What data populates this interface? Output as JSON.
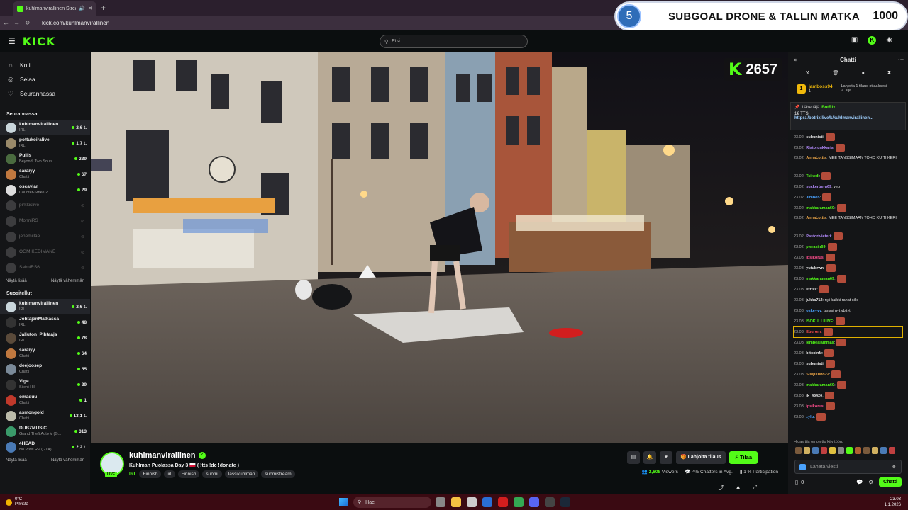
{
  "browser": {
    "tab_title": "kuhlmanvirallinen Stream",
    "url": "kick.com/kuhlmanvirallinen"
  },
  "goal_overlay": {
    "number": "5",
    "text": "SUBGOAL DRONE & TALLIN MATKA",
    "value": "1000"
  },
  "topnav": {
    "logo": "KICK",
    "search_placeholder": "Etsi"
  },
  "sidebar": {
    "nav": [
      {
        "label": "Koti",
        "icon": "home-icon"
      },
      {
        "label": "Selaa",
        "icon": "browse-icon"
      },
      {
        "label": "Seurannassa",
        "icon": "heart-icon"
      }
    ],
    "following_title": "Seurannassa",
    "following": [
      {
        "name": "kuhlmanvirallinen",
        "category": "IRL",
        "viewers": "2,6 t.",
        "color": "#c9d6dc",
        "active": true
      },
      {
        "name": "pottukoiralive",
        "category": "IRL",
        "viewers": "1,7 t.",
        "color": "#9a8a6a"
      },
      {
        "name": "Pullis",
        "category": "Beyond: Two Souls",
        "viewers": "239",
        "color": "#4a6b3f"
      },
      {
        "name": "saraiyy",
        "category": "Chatti",
        "viewers": "67",
        "color": "#c0783f"
      },
      {
        "name": "oscaviar",
        "category": "Counter-Strike 2",
        "viewers": "29",
        "color": "#ddd"
      },
      {
        "name": "pirkkislive",
        "offline": true,
        "color": "#888"
      },
      {
        "name": "MonniRS",
        "offline": true,
        "color": "#888"
      },
      {
        "name": "jenemillae",
        "offline": true,
        "color": "#888"
      },
      {
        "name": "OGMIKEDIMANE",
        "offline": true,
        "color": "#888"
      },
      {
        "name": "SaimiRS6",
        "offline": true,
        "color": "#888"
      }
    ],
    "show_more": "Näytä lisää",
    "show_less": "Näytä vähemmän",
    "recommended_title": "Suositellut",
    "recommended": [
      {
        "name": "kuhlmanvirallinen",
        "category": "IRL",
        "viewers": "2,6 t.",
        "color": "#c9d6dc",
        "active": true
      },
      {
        "name": "JohtajanMatkassa",
        "category": "IRL",
        "viewers": "48",
        "color": "#333"
      },
      {
        "name": "Jaliuton_Pihtaaja",
        "category": "IRL",
        "viewers": "78",
        "color": "#5a4a3a"
      },
      {
        "name": "saraiyy",
        "category": "Chatti",
        "viewers": "64",
        "color": "#c0783f"
      },
      {
        "name": "deejoosep",
        "category": "Chatti",
        "viewers": "55",
        "color": "#7a8a99"
      },
      {
        "name": "Vige",
        "category": "Silent Hill",
        "viewers": "29",
        "color": "#333"
      },
      {
        "name": "omaquu",
        "category": "Chatti",
        "viewers": "1",
        "color": "#c0392b"
      },
      {
        "name": "asmongold",
        "category": "Chatti",
        "viewers": "13,1 t.",
        "color": "#bba"
      },
      {
        "name": "DUBZMUSIC",
        "category": "Grand Theft Auto V (G...",
        "viewers": "313",
        "color": "#3a9a6a"
      },
      {
        "name": "4HEAD",
        "category": "No Pixel RP (GTA)",
        "viewers": "2,2 t.",
        "color": "#4a7ab5"
      }
    ]
  },
  "video": {
    "k_counter": "2657"
  },
  "stream_info": {
    "live_badge": "LIVE",
    "streamer": "kuhlmanvirallinen",
    "title": "Kuhlman Puolassa Day 3 🇵🇱 ( !tts !dc !donate )",
    "category": "IRL",
    "tags": [
      "Finnish",
      "irl",
      "Finnish",
      "suomi",
      "lassikuhlman",
      "suomistream"
    ],
    "gift_label": "Lahjoita tilaus",
    "subscribe_label": "Tilaa",
    "viewers": "2,608",
    "viewers_label": "Viewers",
    "chatters": "4%",
    "chatters_label": "Chatters in Avg.",
    "participation": "1 %",
    "participation_label": "Participation"
  },
  "chat": {
    "title": "Chatti",
    "top_gifter": {
      "rank": "1",
      "name": "jamboss94",
      "count": "1",
      "text": "Lahjoita 1 tilaus ottaaksesi 2. sija"
    },
    "pinned": {
      "sender_label": "Lähettäjä",
      "sender": "BotRix",
      "text": "1€ TTS:",
      "link": "https://botrix.live/k/kuhlmanvirallinen..."
    },
    "messages": [
      {
        "time": "23.02",
        "user": "subunisti",
        "text": "",
        "color": "#e6e6e6",
        "emote": true
      },
      {
        "time": "23.02",
        "user": "Ristorunkkaris",
        "text": "",
        "color": "#b58cff",
        "emote": true
      },
      {
        "time": "23.02",
        "user": "AnnaLottis",
        "text": "MEE TANSSIMAAN TOHO KU TIIKERI",
        "color": "#f0a848",
        "multi": true
      },
      {
        "time": "23.02",
        "user": "Tsikedi",
        "text": "",
        "color": "#53fc18",
        "emote": true
      },
      {
        "time": "23.02",
        "user": "suckerberg69",
        "text": "yep",
        "color": "#b58cff"
      },
      {
        "time": "23.02",
        "user": "Jimbo5",
        "text": "",
        "color": "#4aa3ff",
        "emote": true
      },
      {
        "time": "23.02",
        "user": "makkaraman69",
        "text": "",
        "color": "#53fc18",
        "emote": true
      },
      {
        "time": "23.02",
        "user": "AnnaLottis",
        "text": "MEE TANSSIMAAN TOHO KU TIIKERI",
        "color": "#f0a848",
        "multi": true
      },
      {
        "time": "23.02",
        "user": "Pastorivieteri",
        "text": "",
        "color": "#b58cff",
        "emote": true
      },
      {
        "time": "23.02",
        "user": "pierasin69",
        "text": "",
        "color": "#53fc18",
        "emote": true
      },
      {
        "time": "23.03",
        "user": "ipsikorus",
        "text": "",
        "color": "#ff4d8d",
        "emote": true
      },
      {
        "time": "23.03",
        "user": "yutubrwn",
        "text": "",
        "color": "#e6e6e6",
        "emote": true
      },
      {
        "time": "23.03",
        "user": "makkaraman69",
        "text": "",
        "color": "#53fc18",
        "emote": true
      },
      {
        "time": "23.03",
        "user": "utriss",
        "text": "",
        "color": "#e6e6e6",
        "emote": true
      },
      {
        "time": "23.03",
        "user": "jukka712",
        "text": "nyt kaikki rahat sille",
        "color": "#e6e6e6"
      },
      {
        "time": "23.03",
        "user": "oskeyyy",
        "text": "tanssi nyt vbityt",
        "color": "#4aa3ff"
      },
      {
        "time": "23.03",
        "user": "ISOKULLILIVE",
        "text": "",
        "color": "#53fc18",
        "emote": true
      },
      {
        "time": "23.03",
        "user": "Eburom",
        "text": "",
        "color": "#ff4d4d",
        "emote": true,
        "highlight": true
      },
      {
        "time": "23.03",
        "user": "lempealammas",
        "text": "",
        "color": "#53fc18",
        "emote": true
      },
      {
        "time": "23.03",
        "user": "bitcoinfz",
        "text": "",
        "color": "#e6e6e6",
        "emote": true
      },
      {
        "time": "23.03",
        "user": "subunisti",
        "text": "",
        "color": "#e6e6e6",
        "emote": true
      },
      {
        "time": "23.03",
        "user": "Sisijuusto22",
        "text": "",
        "color": "#f0a848",
        "emote": true
      },
      {
        "time": "23.03",
        "user": "makkaraman69",
        "text": "",
        "color": "#53fc18",
        "emote": true
      },
      {
        "time": "23.03",
        "user": "jk_45420",
        "text": "",
        "color": "#e6e6e6",
        "emote": true
      },
      {
        "time": "23.03",
        "user": "ipsikorus",
        "text": "",
        "color": "#ff4d8d",
        "emote": true
      },
      {
        "time": "23.03",
        "user": "zyliz",
        "text": "",
        "color": "#4aa3ff",
        "emote": true
      }
    ],
    "slow_mode": "Hidas tila on otettu käyttöön.",
    "input_placeholder": "Lähetä viesti",
    "points": "0",
    "chat_button": "Chatti"
  },
  "taskbar": {
    "temp": "0°C",
    "weather": "Pilvistä",
    "search": "Hae",
    "time": "23.03",
    "date": "1.1.2026"
  },
  "colors": {
    "accent": "#53fc18",
    "background": "#0b0e0f",
    "sidebar": "#141517"
  }
}
